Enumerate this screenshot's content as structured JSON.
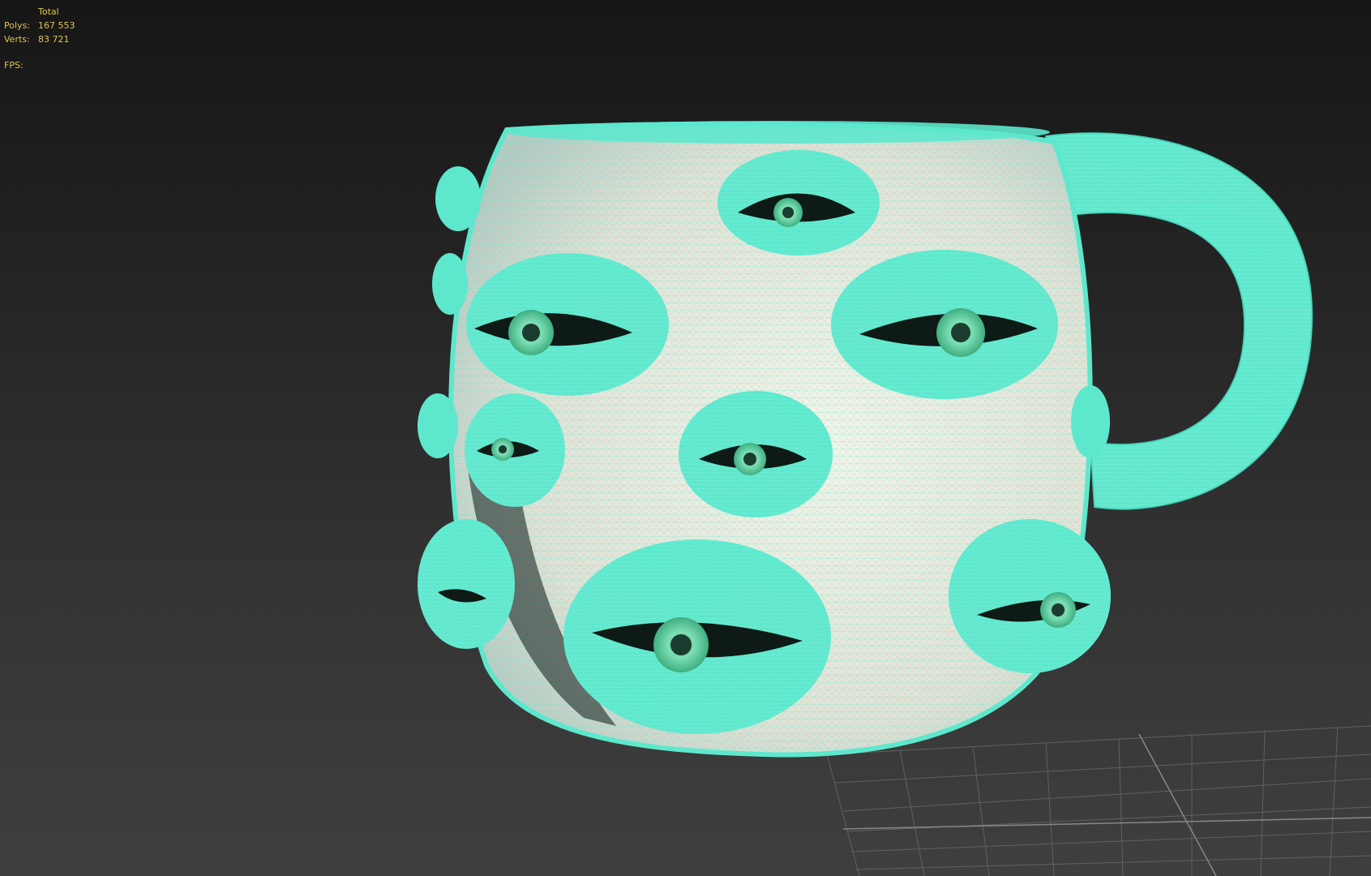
{
  "viewport_stats": {
    "header": "Total",
    "polys_label": "Polys:",
    "polys_value": "167 553",
    "verts_label": "Verts:",
    "verts_value": "83 721",
    "fps_label": "FPS:"
  },
  "colors": {
    "background_top": "#161616",
    "background_bottom": "#3f3f3f",
    "stats_text": "#e2c34e",
    "wireframe": "#5de8cd",
    "mug_body": "#e9e6dc",
    "iris": "#52c08f",
    "grid": "#6a6a6a"
  },
  "scene": {
    "object": "mug-with-eyes",
    "display_mode": "wireframe-over-shaded"
  }
}
